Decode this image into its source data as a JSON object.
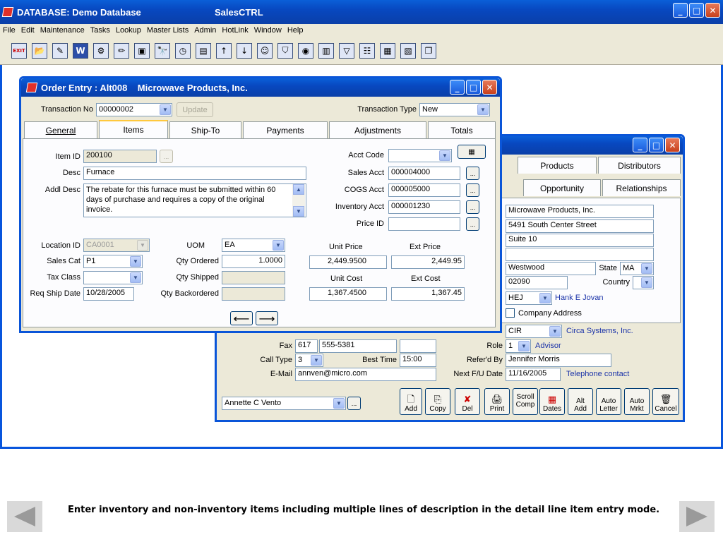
{
  "main": {
    "title_left": "DATABASE:  Demo Database",
    "title_right": "SalesCTRL",
    "menu": [
      "File",
      "Edit",
      "Maintenance",
      "Tasks",
      "Lookup",
      "Master Lists",
      "Admin",
      "HotLink",
      "Window",
      "Help"
    ],
    "toolbar_icons": [
      "EXIT",
      "📂",
      "✎",
      "W",
      "⚙",
      "✏",
      "▣",
      "🔭",
      "◷",
      "▤",
      "↑",
      "↓",
      "☺",
      "⛉",
      "◉",
      "▥",
      "▽",
      "☷",
      "▦",
      "▧",
      "❐"
    ]
  },
  "contact": {
    "tabs_row1": [
      "Products",
      "Distributors"
    ],
    "tabs_row2": [
      "Opportunity",
      "Relationships"
    ],
    "company": "Microwave Products, Inc.",
    "address1": "5491 South Center Street",
    "address2": "Suite 10",
    "address3": "",
    "city": "Westwood",
    "state_label": "State",
    "state": "MA",
    "zip": "02090",
    "country_label": "Country",
    "rep": "HEJ",
    "rep_name": "Hank E Jovan",
    "company_address_label": "Company Address",
    "lead": "CIR",
    "lead_name": "Circa Systems, Inc.",
    "fax_label": "Fax",
    "fax_area": "617",
    "fax_number": "555-5381",
    "role_label": "Role",
    "role": "1",
    "role_name": "Advisor",
    "call_type_label": "Call Type",
    "call_type": "3",
    "best_time_label": "Best Time",
    "best_time": "15:00",
    "referd_by_label": "Refer'd By",
    "referd_by": "Jennifer Morris",
    "email_label": "E-Mail",
    "email": "annven@micro.com",
    "next_fu_label": "Next F/U Date",
    "next_fu": "11/16/2005",
    "next_fu_note": "Telephone contact",
    "contact_name": "Annette C Vento",
    "buttons": [
      {
        "icon": "🗋",
        "label": "Add"
      },
      {
        "icon": "⎘",
        "label": "Copy"
      },
      {
        "icon": "✘",
        "label": "Del"
      },
      {
        "icon": "🖨",
        "label": "Print"
      },
      {
        "icon": "",
        "label": "Scroll Comp"
      },
      {
        "icon": "▦",
        "label": "Dates"
      },
      {
        "icon": "Alt",
        "label": "Add"
      },
      {
        "icon": "Auto",
        "label": "Letter"
      },
      {
        "icon": "Auto",
        "label": "Mrkt"
      },
      {
        "icon": "🗑",
        "label": "Cancel"
      }
    ]
  },
  "order": {
    "title": "Order Entry : Alt008    Microwave Products, Inc.",
    "transaction_no_label": "Transaction No",
    "transaction_no": "00000002",
    "update_label": "Update",
    "transaction_type_label": "Transaction Type",
    "transaction_type": "New",
    "tabs": [
      "General",
      "Items",
      "Ship-To",
      "Payments",
      "Adjustments",
      "Totals"
    ],
    "item_id_label": "Item ID",
    "item_id": "200100",
    "desc_label": "Desc",
    "desc": "Furnace",
    "addl_desc_label": "Addl Desc",
    "addl_desc": "The rebate for this furnace must be submitted within 60 days of purchase and requires a copy of the original invoice.",
    "acct_code_label": "Acct Code",
    "sales_acct_label": "Sales Acct",
    "sales_acct": "000004000",
    "cogs_acct_label": "COGS Acct",
    "cogs_acct": "000005000",
    "inventory_acct_label": "Inventory Acct",
    "inventory_acct": "000001230",
    "price_id_label": "Price ID",
    "location_id_label": "Location ID",
    "location_id": "CA0001",
    "sales_cat_label": "Sales Cat",
    "sales_cat": "P1",
    "tax_class_label": "Tax Class",
    "req_ship_date_label": "Req Ship Date",
    "req_ship_date": "10/28/2005",
    "uom_label": "UOM",
    "uom": "EA",
    "qty_ordered_label": "Qty Ordered",
    "qty_ordered": "1.0000",
    "qty_shipped_label": "Qty Shipped",
    "qty_backordered_label": "Qty Backordered",
    "unit_price_label": "Unit Price",
    "unit_price": "2,449.9500",
    "ext_price_label": "Ext Price",
    "ext_price": "2,449.95",
    "unit_cost_label": "Unit Cost",
    "unit_cost": "1,367.4500",
    "ext_cost_label": "Ext Cost",
    "ext_cost": "1,367.45"
  },
  "footer": {
    "caption": "Enter inventory and non-inventory items including multiple lines of description in the detail line item entry mode."
  }
}
